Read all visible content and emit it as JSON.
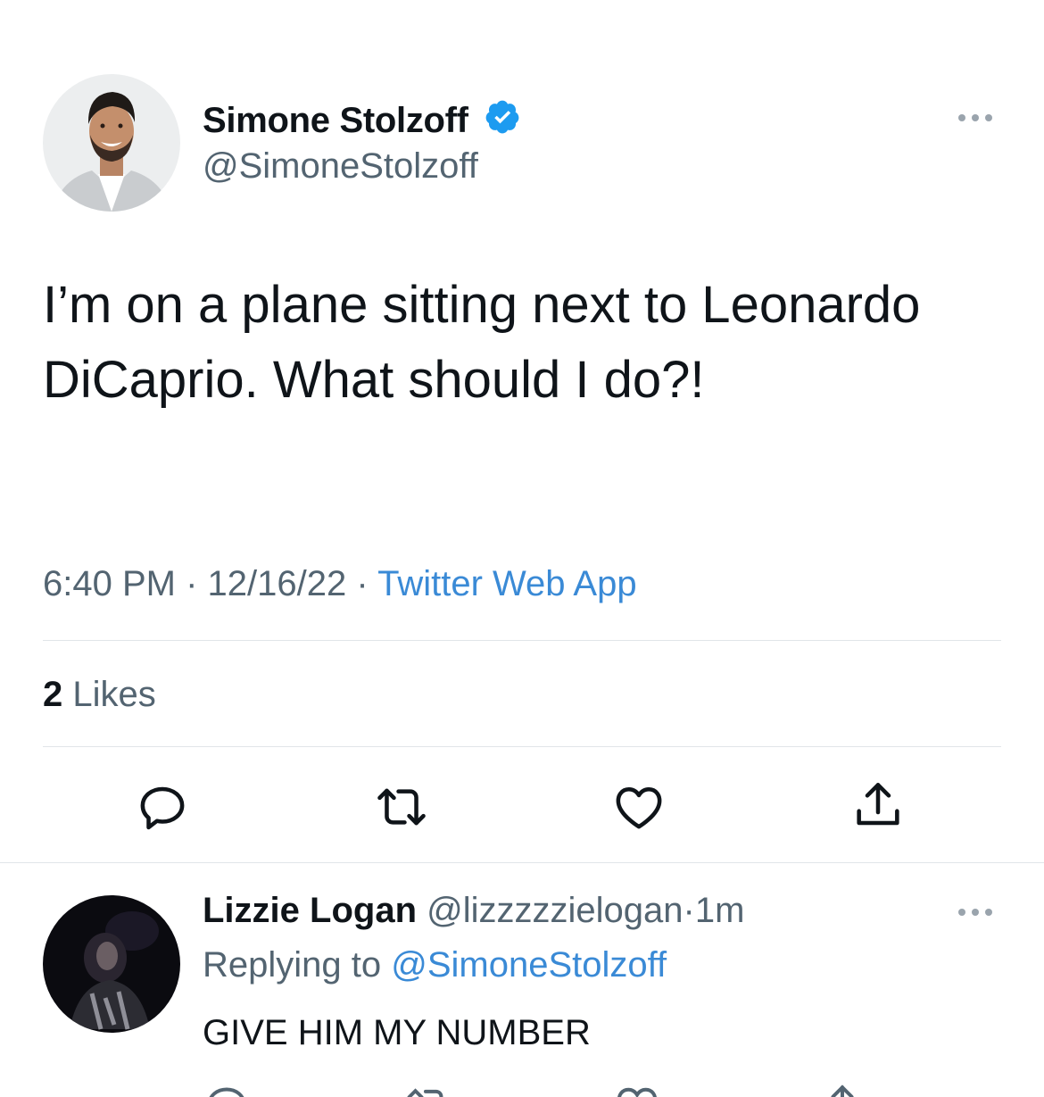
{
  "tweet": {
    "author": {
      "name": "Simone Stolzoff",
      "handle": "@SimoneStolzoff",
      "verified": true,
      "avatar": "man-smiling-avatar"
    },
    "text": "I’m on a plane sitting next to Leonardo DiCaprio. What should I do?!",
    "time": "6:40 PM",
    "date": "12/16/22",
    "separator": "·",
    "source": "Twitter Web App",
    "likes_count": "2",
    "likes_label": "Likes",
    "actions": [
      "reply-icon",
      "retweet-icon",
      "like-icon",
      "share-icon"
    ],
    "colors": {
      "link": "#3a8ad6",
      "verified": "#1d9bf0",
      "muted": "#536471"
    }
  },
  "reply": {
    "author": {
      "name": "Lizzie Logan",
      "handle": "@lizzzzzielogan",
      "avatar": "dark-photo-avatar"
    },
    "separator": "·",
    "time": "1m",
    "replying_prefix": "Replying to",
    "replying_to": "@SimoneStolzoff",
    "text": "GIVE HIM MY NUMBER"
  }
}
